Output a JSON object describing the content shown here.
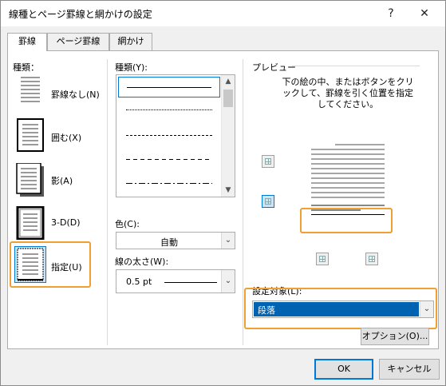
{
  "window": {
    "title": "線種とページ罫線と網かけの設定",
    "help_icon": "?",
    "close_icon": "✕"
  },
  "tabs": [
    {
      "label": "罫線",
      "active": true
    },
    {
      "label": "ページ罫線",
      "active": false
    },
    {
      "label": "網かけ",
      "active": false
    }
  ],
  "setting": {
    "heading": "種類：",
    "items": [
      {
        "label": "罫線なし(N)",
        "icon": "no-border-icon"
      },
      {
        "label": "囲む(X)",
        "icon": "box-border-icon"
      },
      {
        "label": "影(A)",
        "icon": "shadow-border-icon"
      },
      {
        "label": "3-D(D)",
        "icon": "3d-border-icon"
      },
      {
        "label": "指定(U)",
        "icon": "custom-border-icon",
        "selected": true
      }
    ]
  },
  "style": {
    "heading": "種類(Y):",
    "line_styles": [
      "solid",
      "dotted",
      "dashed-short",
      "dashed",
      "dash-dot"
    ],
    "color_label": "色(C):",
    "color_value": "自動",
    "width_label": "線の太さ(W):",
    "width_value": "0.5 pt"
  },
  "preview": {
    "heading": "プレビュー",
    "instruction": "下の絵の中、またはボタンをクリックして、罫線を引く位置を指定してください。",
    "apply_to_label": "設定対象(L):",
    "apply_to_value": "段落",
    "options_button": "オプション(O)..."
  },
  "buttons": {
    "ok": "OK",
    "cancel": "キャンセル"
  },
  "colors": {
    "highlight": "#f0a030",
    "selection": "#0063b1",
    "accent": "#0078d7"
  }
}
